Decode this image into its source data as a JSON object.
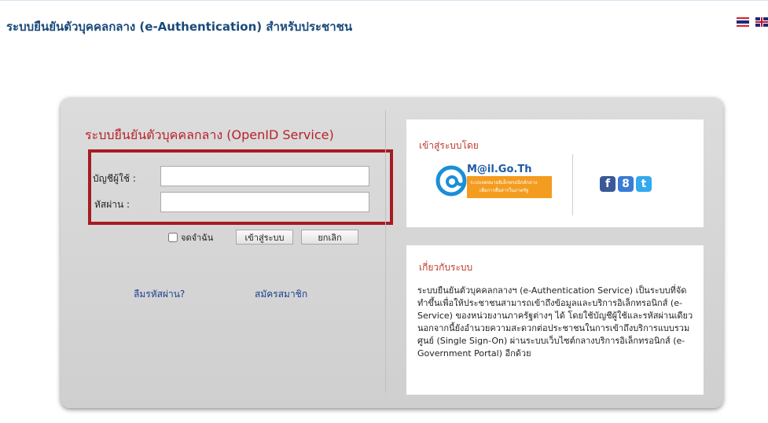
{
  "header": {
    "title": "ระบบยืนยันตัวบุคคลกลาง (e-Authentication) สำหรับประชาชน",
    "flags": [
      "thai-flag-icon",
      "uk-flag-icon"
    ]
  },
  "login": {
    "title": "ระบบยืนยันตัวบุคคลกลาง (OpenID Service)",
    "username_label": "บัญชีผู้ใช้ :",
    "password_label": "หัสผ่าน :",
    "username_value": "",
    "password_value": "",
    "remember_label": "จดจำฉัน",
    "login_button": "เข้าสู่ระบบ",
    "cancel_button": "ยกเลิก",
    "forgot_link": "ลืมรหัสผ่าน?",
    "register_link": "สมัครสมาชิก"
  },
  "signin_with": {
    "title": "เข้าสู่ระบบโดย",
    "mail_logo_text": "M@il.Go.Th",
    "mail_logo_sub1": "ระบบจดหมายอิเล็กทรอนิกส์กลาง",
    "mail_logo_sub2": "เพื่อการสื่อสารในภาครัฐ",
    "social": [
      {
        "name": "facebook-icon",
        "glyph": "f",
        "color": "#3b5998"
      },
      {
        "name": "google-plus-icon",
        "glyph": "8",
        "color": "#3a7bd5"
      },
      {
        "name": "twitter-icon",
        "glyph": "t",
        "color": "#33aaee"
      }
    ]
  },
  "about": {
    "title": "เกี่ยวกับระบบ",
    "text": "ระบบยืนยันตัวบุคคลกลางฯ (e-Authentication Service) เป็นระบบที่จัดทำขึ้นเพื่อให้ประชาชนสามารถเข้าถึงข้อมูลและบริการอิเล็กทรอนิกส์ (e-Service) ของหน่วยงานภาครัฐต่างๆ ได้ โดยใช้บัญชีผู้ใช้และรหัสผ่านเดียว นอกจากนี้ยังอำนวยความสะดวกต่อประชาชนในการเข้าถึงบริการแบบรวมศูนย์ (Single Sign-On) ผ่านระบบเว็บไซต์กลางบริการอิเล็กทรอนิกส์ (e-Government Portal) อีกด้วย"
  },
  "colors": {
    "title_blue": "#1a4a7a",
    "accent_red": "#b8222a",
    "link_blue": "#1a3f8f"
  }
}
